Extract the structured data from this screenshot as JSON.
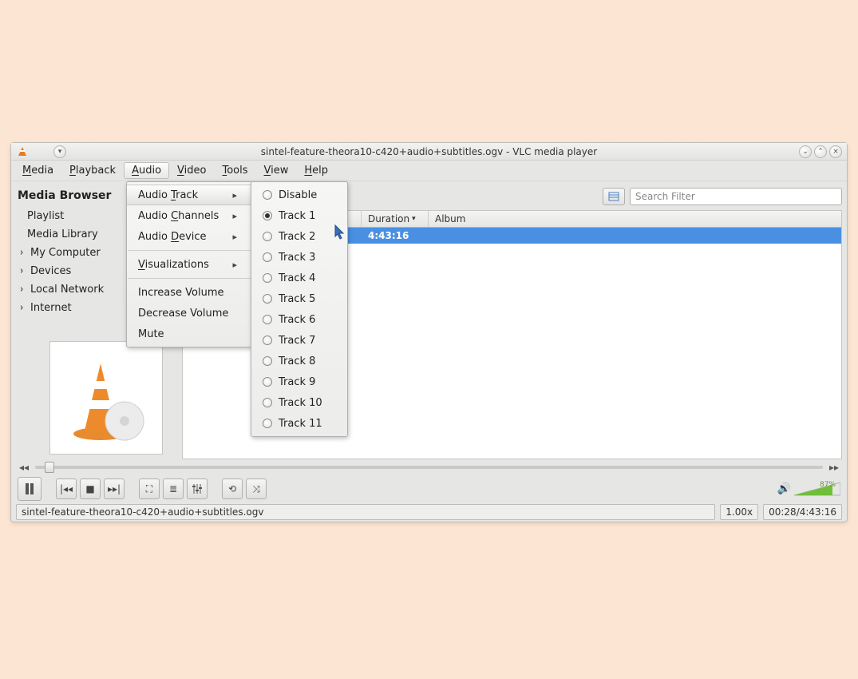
{
  "title": "sintel-feature-theora10-c420+audio+subtitles.ogv - VLC media player",
  "menubar": [
    "Media",
    "Playback",
    "Audio",
    "Video",
    "Tools",
    "View",
    "Help"
  ],
  "menubar_u": [
    "M",
    "P",
    "A",
    "V",
    "T",
    "V",
    "H"
  ],
  "active_menu_index": 2,
  "audio_menu": {
    "items": [
      {
        "label": "Audio Track",
        "u": "T",
        "sub": true,
        "hov": true
      },
      {
        "label": "Audio Channels",
        "u": "C",
        "sub": true
      },
      {
        "label": "Audio Device",
        "u": "D",
        "sub": true
      },
      {
        "sep": true
      },
      {
        "label": "Visualizations",
        "u": "V",
        "sub": true
      },
      {
        "sep": true
      },
      {
        "label": "Increase Volume"
      },
      {
        "label": "Decrease Volume"
      },
      {
        "label": "Mute"
      }
    ]
  },
  "track_menu": {
    "items": [
      {
        "label": "Disable"
      },
      {
        "label": "Track 1",
        "sel": true
      },
      {
        "label": "Track 2"
      },
      {
        "label": "Track 3"
      },
      {
        "label": "Track 4"
      },
      {
        "label": "Track 5"
      },
      {
        "label": "Track 6"
      },
      {
        "label": "Track 7"
      },
      {
        "label": "Track 8"
      },
      {
        "label": "Track 9"
      },
      {
        "label": "Track 10"
      },
      {
        "label": "Track 11"
      }
    ]
  },
  "sidebar": {
    "title": "Media Browser",
    "items": [
      {
        "label": "Playlist",
        "exp": false
      },
      {
        "label": "Media Library",
        "exp": false
      },
      {
        "label": "My Computer",
        "exp": true
      },
      {
        "label": "Devices",
        "exp": true
      },
      {
        "label": "Local Network",
        "exp": true
      },
      {
        "label": "Internet",
        "exp": true
      }
    ]
  },
  "search_placeholder": "Search Filter",
  "columns": {
    "duration": "Duration",
    "album": "Album"
  },
  "playlist_row": {
    "duration": "4:43:16"
  },
  "volume_pct": "87%",
  "status": {
    "file": "sintel-feature-theora10-c420+audio+subtitles.ogv",
    "speed": "1.00x",
    "time": "00:28/4:43:16"
  }
}
